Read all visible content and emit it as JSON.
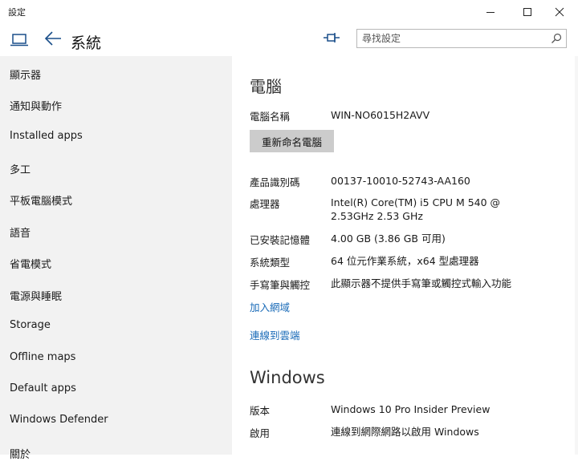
{
  "window": {
    "title": "設定",
    "minimize_icon": "minimize-icon",
    "maximize_icon": "maximize-icon",
    "close_icon": "close-icon"
  },
  "header": {
    "page_title": "系統",
    "search_placeholder": "尋找設定"
  },
  "sidebar": {
    "items": [
      {
        "label": "顯示器"
      },
      {
        "label": "通知與動作"
      },
      {
        "label": "Installed apps"
      },
      {
        "label": "多工"
      },
      {
        "label": "平板電腦模式"
      },
      {
        "label": "語音"
      },
      {
        "label": "省電模式"
      },
      {
        "label": "電源與睡眠"
      },
      {
        "label": "Storage"
      },
      {
        "label": "Offline maps"
      },
      {
        "label": "Default apps"
      },
      {
        "label": "Windows Defender"
      },
      {
        "label": "關於"
      }
    ]
  },
  "pc": {
    "section_title": "電腦",
    "name_label": "電腦名稱",
    "name_value": "WIN-NO6015H2AVV",
    "rename_button": "重新命名電腦",
    "product_id_label": "產品識別碼",
    "product_id_value": "00137-10010-52743-AA160",
    "processor_label": "處理器",
    "processor_line1": "Intel(R) Core(TM) i5 CPU       M 540  @",
    "processor_line2": "2.53GHz   2.53 GHz",
    "ram_label": "已安裝記憶體",
    "ram_value": "4.00 GB (3.86 GB 可用)",
    "system_type_label": "系統類型",
    "system_type_value": "64 位元作業系統，x64 型處理器",
    "pen_touch_label": "手寫筆與觸控",
    "pen_touch_value": "此顯示器不提供手寫筆或觸控式輸入功能",
    "join_domain_link": "加入網域",
    "join_cloud_link": "連線到雲端"
  },
  "windows": {
    "section_title": "Windows",
    "edition_label": "版本",
    "edition_value": "Windows 10 Pro Insider Preview",
    "activation_label": "啟用",
    "activation_value": "連線到網際網路以啟用 Windows"
  }
}
